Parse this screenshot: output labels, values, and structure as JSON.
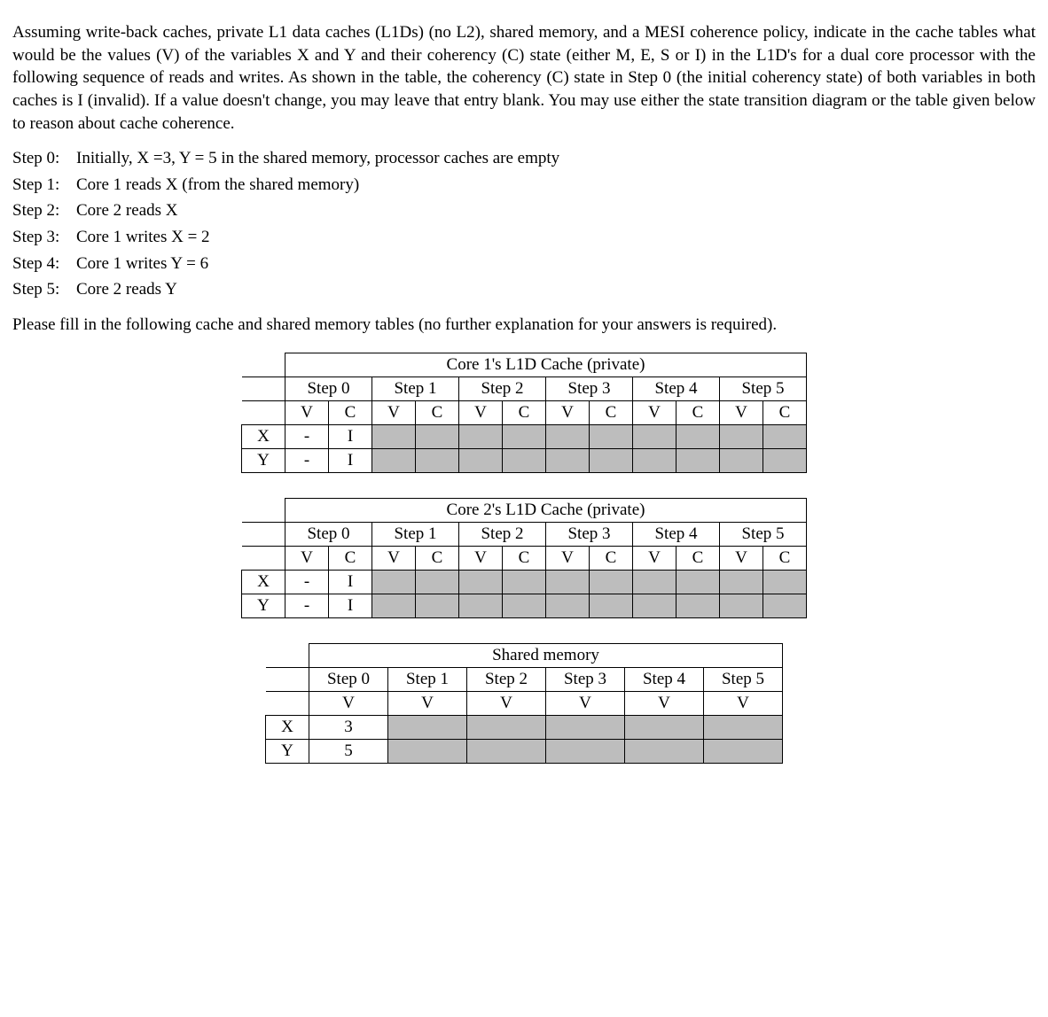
{
  "intro": "Assuming write-back caches, private L1 data caches (L1Ds) (no L2), shared memory, and a MESI coherence policy, indicate in the cache tables what would be the values (V) of the variables X and Y and their coherency (C) state (either M, E, S or I) in the L1D's for a dual core processor with the following sequence of reads and writes. As shown in the table, the coherency (C) state in Step 0 (the initial coherency state) of both variables in both caches is I (invalid). If a value doesn't change, you may leave that entry blank. You may use either the state transition diagram or the table given below to reason about cache coherence.",
  "steps": [
    {
      "label": "Step 0:",
      "text": "Initially, X =3, Y = 5 in the shared memory, processor caches are empty"
    },
    {
      "label": "Step 1:",
      "text": "Core 1 reads X (from the shared memory)"
    },
    {
      "label": "Step 2:",
      "text": "Core 2 reads X"
    },
    {
      "label": "Step 3:",
      "text": "Core 1 writes X = 2"
    },
    {
      "label": "Step 4:",
      "text": "Core 1 writes Y = 6"
    },
    {
      "label": "Step 5:",
      "text": "Core 2 reads Y"
    }
  ],
  "instruction": "Please fill in the following cache and shared memory tables (no further explanation for your answers is required).",
  "labels": {
    "X": "X",
    "Y": "Y",
    "V": "V",
    "C": "C",
    "step0": "Step 0",
    "step1": "Step 1",
    "step2": "Step 2",
    "step3": "Step 3",
    "step4": "Step 4",
    "step5": "Step 5"
  },
  "chart_data": [
    {
      "type": "table",
      "title": "Core 1's L1D Cache (private)",
      "columns": [
        "Step 0",
        "Step 1",
        "Step 2",
        "Step 3",
        "Step 4",
        "Step 5"
      ],
      "sub_columns": [
        "V",
        "C"
      ],
      "rows": [
        {
          "var": "X",
          "cells": [
            [
              "-",
              "I"
            ],
            [
              "",
              ""
            ],
            [
              "",
              ""
            ],
            [
              "",
              ""
            ],
            [
              "",
              ""
            ],
            [
              "",
              ""
            ]
          ]
        },
        {
          "var": "Y",
          "cells": [
            [
              "-",
              "I"
            ],
            [
              "",
              ""
            ],
            [
              "",
              ""
            ],
            [
              "",
              ""
            ],
            [
              "",
              ""
            ],
            [
              "",
              ""
            ]
          ]
        }
      ]
    },
    {
      "type": "table",
      "title": "Core 2's L1D Cache (private)",
      "columns": [
        "Step 0",
        "Step 1",
        "Step 2",
        "Step 3",
        "Step 4",
        "Step 5"
      ],
      "sub_columns": [
        "V",
        "C"
      ],
      "rows": [
        {
          "var": "X",
          "cells": [
            [
              "-",
              "I"
            ],
            [
              "",
              ""
            ],
            [
              "",
              ""
            ],
            [
              "",
              ""
            ],
            [
              "",
              ""
            ],
            [
              "",
              ""
            ]
          ]
        },
        {
          "var": "Y",
          "cells": [
            [
              "-",
              "I"
            ],
            [
              "",
              ""
            ],
            [
              "",
              ""
            ],
            [
              "",
              ""
            ],
            [
              "",
              ""
            ],
            [
              "",
              ""
            ]
          ]
        }
      ]
    },
    {
      "type": "table",
      "title": "Shared memory",
      "columns": [
        "Step 0",
        "Step 1",
        "Step 2",
        "Step 3",
        "Step 4",
        "Step 5"
      ],
      "sub_columns": [
        "V"
      ],
      "rows": [
        {
          "var": "X",
          "cells": [
            [
              "3"
            ],
            [
              ""
            ],
            [
              ""
            ],
            [
              ""
            ],
            [
              ""
            ],
            [
              ""
            ]
          ]
        },
        {
          "var": "Y",
          "cells": [
            [
              "5"
            ],
            [
              ""
            ],
            [
              ""
            ],
            [
              ""
            ],
            [
              ""
            ],
            [
              ""
            ]
          ]
        }
      ]
    }
  ]
}
